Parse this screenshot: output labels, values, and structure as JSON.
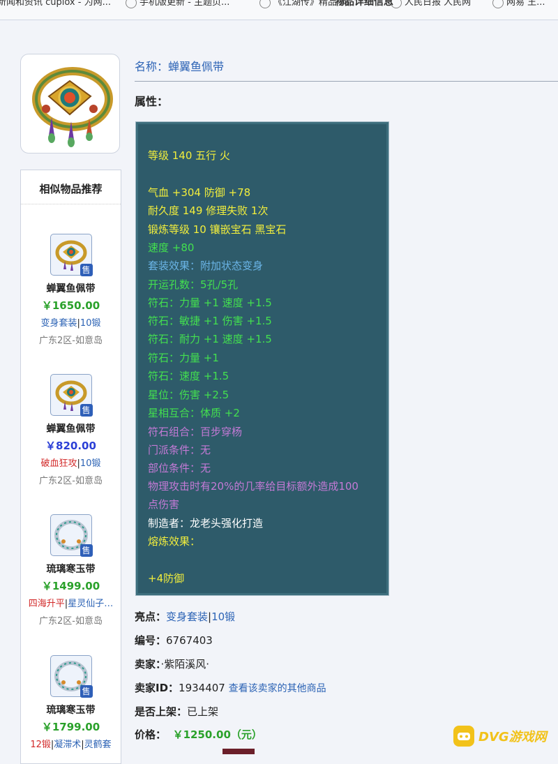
{
  "browser_tabs": [
    "新闻和资讯 cupiox - 为网...",
    "手机版更新 - 主题页...",
    "《江湖传》精品 网...",
    "人民日报 人民网",
    "网易 王..."
  ],
  "page_title": "物品详细信息",
  "item": {
    "name_label": "名称：",
    "name": "蝉翼鱼佩带",
    "attr_label": "属性：",
    "attributes": [
      {
        "text": "等级 140 五行 火",
        "color": "#f2ee3c"
      },
      {
        "text": "气血 +304 防御 +78",
        "color": "#f2ee3c"
      },
      {
        "text": "耐久度 149 修理失败 1次",
        "color": "#f2ee3c"
      },
      {
        "text": "锻炼等级 10 镶嵌宝石 黑宝石",
        "color": "#f2ee3c"
      },
      {
        "text": "速度 +80",
        "color": "#43e04f"
      },
      {
        "text": "套装效果：附加状态变身",
        "color": "#6ab4e6"
      },
      {
        "text": "开运孔数：5孔/5孔",
        "color": "#43e04f"
      },
      {
        "text": "符石：力量 +1 速度 +1.5",
        "color": "#43e04f"
      },
      {
        "text": "符石：敏捷 +1 伤害 +1.5",
        "color": "#43e04f"
      },
      {
        "text": "符石：耐力 +1 速度 +1.5",
        "color": "#43e04f"
      },
      {
        "text": "符石：力量 +1",
        "color": "#43e04f"
      },
      {
        "text": "符石：速度 +1.5",
        "color": "#43e04f"
      },
      {
        "text": "星位：伤害 +2.5",
        "color": "#43e04f"
      },
      {
        "text": "星相互合：体质 +2",
        "color": "#43e04f"
      },
      {
        "text": "符石组合：百步穿杨",
        "color": "#c47ad6"
      },
      {
        "text": "门派条件：无",
        "color": "#c47ad6"
      },
      {
        "text": "部位条件：无",
        "color": "#c47ad6"
      },
      {
        "text": "物理攻击时有20%的几率给目标额外造成100",
        "color": "#c47ad6"
      },
      {
        "text": "点伤害",
        "color": "#c47ad6"
      },
      {
        "text": "制造者：龙老头强化打造",
        "color": "#ffffff"
      },
      {
        "text": "熔炼效果：",
        "color": "#f2ee3c"
      },
      {
        "text": "+4防御",
        "color": "#f2ee3c"
      }
    ],
    "highlight_label": "亮点：",
    "highlight_1": "变身套装",
    "highlight_sep": "|",
    "highlight_2": "10锻",
    "id_label": "编号：",
    "id": "6767403",
    "seller_label": "卖家：",
    "seller": "·紫陌溪风·",
    "seller_id_label": "卖家ID：",
    "seller_id": "1934407",
    "seller_link": "查看该卖家的其他商品",
    "listed_label": "是否上架：",
    "listed": "已上架",
    "price_label": "价格：",
    "price": "￥1250.00（元）",
    "price_color": "#2aa12a"
  },
  "sidebar": {
    "title": "相似物品推荐",
    "items": [
      {
        "name": "蝉翼鱼佩带",
        "price": "￥1650.00",
        "price_color": "#2aa12a",
        "tag1": "变身套装",
        "tag1_color": "#2c63b5",
        "sep": "|",
        "tag2": "10锻",
        "tag2_color": "#2c63b5",
        "server": "广东2区-如意岛",
        "badge": "售",
        "gem": "ring-gold"
      },
      {
        "name": "蝉翼鱼佩带",
        "price": "￥820.00",
        "price_color": "#2b3fd6",
        "tag1": "破血狂攻",
        "tag1_color": "#d22a2a",
        "sep": "|",
        "tag2": "10锻",
        "tag2_color": "#2c63b5",
        "server": "广东2区-如意岛",
        "badge": "售",
        "gem": "ring-gold"
      },
      {
        "name": "琉璃寒玉带",
        "price": "￥1499.00",
        "price_color": "#2aa12a",
        "tag1": "四海升平",
        "tag1_color": "#d22a2a",
        "sep": "|",
        "tag2": "星灵仙子…",
        "tag2_color": "#2c63b5",
        "server": "广东2区-如意岛",
        "badge": "售",
        "gem": "ring-silver"
      },
      {
        "name": "琉璃寒玉带",
        "price": "￥1799.00",
        "price_color": "#2aa12a",
        "tag1": "12锻",
        "tag1_color": "#d22a2a",
        "sep": "|",
        "tag2": "凝滞术",
        "tag2_color": "#2c63b5",
        "tag3": "灵鹤套",
        "tag3_color": "#2c63b5",
        "server": "",
        "badge": "售",
        "gem": "ring-silver"
      }
    ]
  },
  "watermark": "DVG游戏网"
}
